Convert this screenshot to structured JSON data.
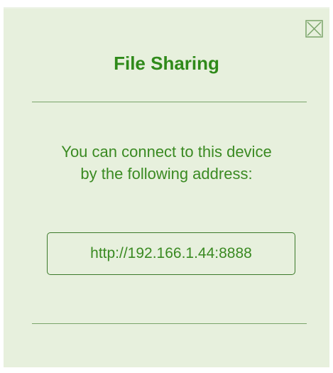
{
  "dialog": {
    "title": "File Sharing",
    "message_line1": "You can connect to this device",
    "message_line2": "by the following address:",
    "address": "http://192.166.1.44:8888",
    "close_icon": "close-icon"
  },
  "colors": {
    "background": "#e7f0dd",
    "accent_green": "#2f8a1a",
    "divider": "#7aa46a"
  }
}
